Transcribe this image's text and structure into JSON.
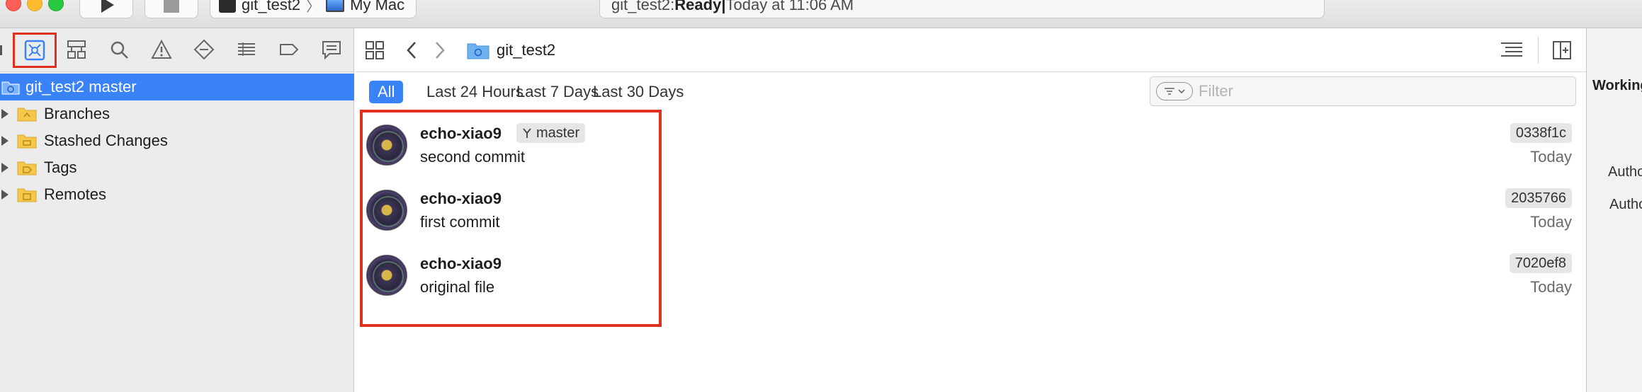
{
  "titlebar": {
    "scheme_project": "git_test2",
    "scheme_destination": "My Mac",
    "activity_prefix": "git_test2: ",
    "activity_status": "Ready",
    "activity_separator": " | ",
    "activity_time": "Today at 11:06 AM"
  },
  "navigator": {
    "tabs": [
      "project-navigator",
      "source-control-navigator",
      "symbol-navigator",
      "find-navigator",
      "issue-navigator",
      "test-navigator",
      "debug-navigator",
      "breakpoint-navigator",
      "report-navigator"
    ],
    "repo_label": "git_test2 master",
    "items": [
      {
        "label": "Branches"
      },
      {
        "label": "Stashed Changes"
      },
      {
        "label": "Tags"
      },
      {
        "label": "Remotes"
      }
    ]
  },
  "toolbar": {
    "breadcrumb": "git_test2"
  },
  "filter": {
    "tabs": [
      "All",
      "Last 24 Hours",
      "Last 7 Days",
      "Last 30 Days"
    ],
    "active_tab": "All",
    "placeholder": "Filter"
  },
  "commits": [
    {
      "author": "echo-xiao9",
      "branch": "master",
      "message": "second commit",
      "hash": "0338f1c",
      "date": "Today"
    },
    {
      "author": "echo-xiao9",
      "message": "first commit",
      "hash": "2035766",
      "date": "Today"
    },
    {
      "author": "echo-xiao9",
      "message": "original file",
      "hash": "7020ef8",
      "date": "Today"
    }
  ],
  "inspector": {
    "title": "Working",
    "author_label_1": "Author",
    "author_label_2": "Author"
  },
  "colors": {
    "accent": "#3a82f7",
    "highlight": "#e0301e",
    "folder": "#f5c84c"
  }
}
